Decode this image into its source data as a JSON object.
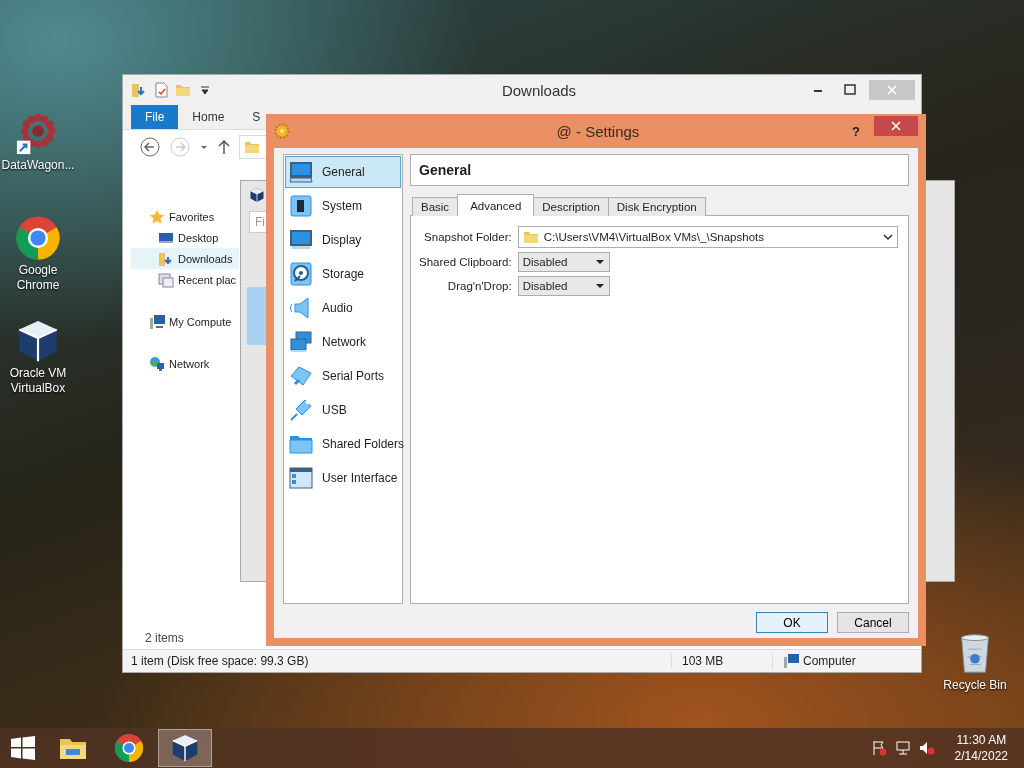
{
  "desktop_icons": [
    {
      "label": "DataWagon..."
    },
    {
      "label": "Google Chrome"
    },
    {
      "label": "Oracle VM VirtualBox"
    },
    {
      "label": "Recycle Bin"
    }
  ],
  "explorer": {
    "title": "Downloads",
    "ribbon_tabs": [
      {
        "label": "File",
        "selected": true
      },
      {
        "label": "Home",
        "selected": false
      },
      {
        "label": "S",
        "selected": false
      }
    ],
    "nav": [
      {
        "label": "Favorites",
        "selected": false,
        "children": [
          {
            "label": "Desktop",
            "selected": false
          },
          {
            "label": "Downloads",
            "selected": true
          },
          {
            "label": "Recent plac",
            "selected": false
          }
        ]
      },
      {
        "label": "My Compute",
        "selected": false
      },
      {
        "label": "Network",
        "selected": false
      }
    ],
    "item_count": "2 items",
    "status_bar": {
      "info": "1 item (Disk free space: 99.3 GB)",
      "size": "103 MB",
      "location": "Computer"
    }
  },
  "manager_window": {
    "search_placeholder": "Fi"
  },
  "settings": {
    "title": "@ - Settings",
    "help": "?",
    "sections": [
      {
        "label": "General",
        "selected": true
      },
      {
        "label": "System",
        "selected": false
      },
      {
        "label": "Display",
        "selected": false
      },
      {
        "label": "Storage",
        "selected": false
      },
      {
        "label": "Audio",
        "selected": false
      },
      {
        "label": "Network",
        "selected": false
      },
      {
        "label": "Serial Ports",
        "selected": false
      },
      {
        "label": "USB",
        "selected": false
      },
      {
        "label": "Shared Folders",
        "selected": false
      },
      {
        "label": "User Interface",
        "selected": false
      }
    ],
    "page_title": "General",
    "tabs": [
      {
        "label": "Basic",
        "selected": false
      },
      {
        "label": "Advanced",
        "selected": true
      },
      {
        "label": "Description",
        "selected": false
      },
      {
        "label": "Disk Encryption",
        "selected": false
      }
    ],
    "fields": [
      {
        "label": "Snapshot Folder:",
        "value": "C:\\Users\\VM4\\VirtualBox VMs\\_\\Snapshots",
        "kind": "path"
      },
      {
        "label": "Shared Clipboard:",
        "value": "Disabled",
        "kind": "combo"
      },
      {
        "label": "Drag'n'Drop:",
        "value": "Disabled",
        "kind": "combo"
      }
    ],
    "buttons": [
      {
        "label": "OK",
        "default": true
      },
      {
        "label": "Cancel",
        "default": false
      }
    ]
  },
  "taskbar": {
    "apps": [
      {
        "selected": false
      },
      {
        "selected": false
      },
      {
        "selected": true
      }
    ],
    "clock": {
      "time": "11:30 AM",
      "date": "2/14/2022"
    }
  }
}
